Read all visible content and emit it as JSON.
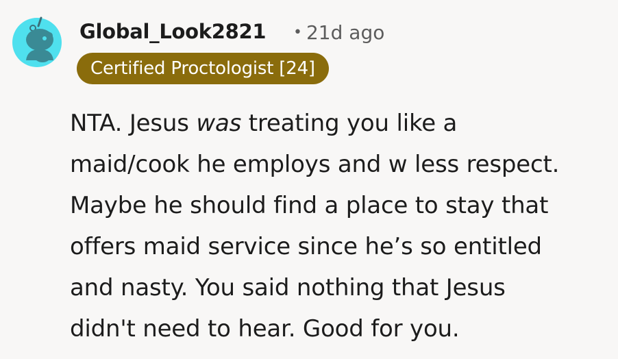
{
  "comment": {
    "author": "Global_Look2821",
    "separator": "•",
    "timestamp": "21d ago",
    "flair": "Certified Proctologist [24]",
    "body": {
      "line1_pre": "NTA. Jesus ",
      "line1_em": "was",
      "line1_post": " treating you like a",
      "line2": "maid/cook he employs and w less respect.",
      "line3": "Maybe he should find a place to stay that",
      "line4": "offers maid service since he’s so entitled",
      "line5": "and nasty. You said nothing that Jesus",
      "line6": "didn't need to hear. Good for you."
    }
  },
  "colors": {
    "background": "#f8f7f6",
    "avatar": "#4fe0ee",
    "flair_bg": "#8a6c0c",
    "flair_text": "#ffffff",
    "meta_text": "#5c5c5c"
  },
  "icons": {
    "avatar": "reddit-snoo-avatar-icon"
  }
}
